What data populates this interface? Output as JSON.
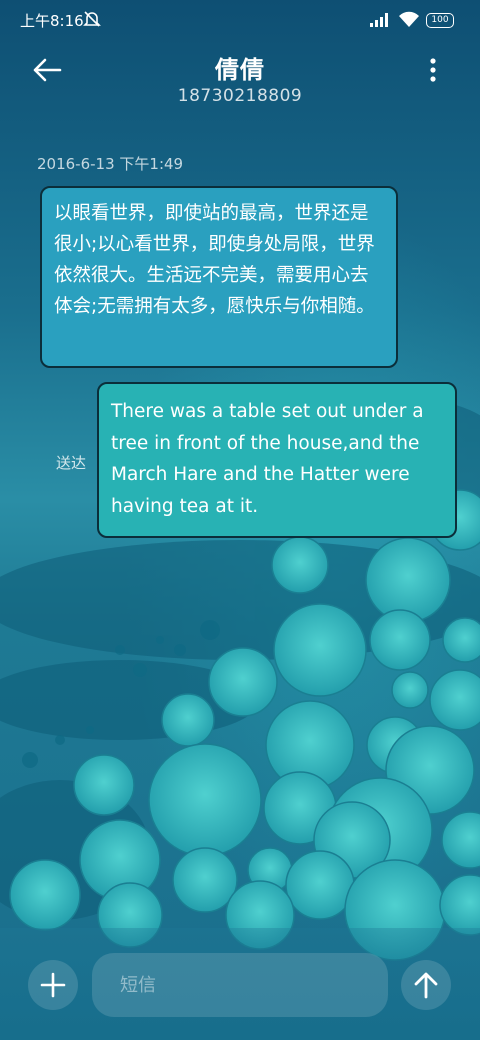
{
  "status_bar": {
    "time": "上午8:16",
    "battery": "100",
    "icons": [
      "mute-icon",
      "signal-icon",
      "wifi-icon",
      "battery-icon"
    ]
  },
  "header": {
    "contact_name": "倩倩",
    "phone_number": "18730218809",
    "icons": [
      "back-arrow-icon",
      "more-vertical-icon"
    ]
  },
  "conversation": {
    "timestamp": "2016-6-13 下午1:49",
    "messages": [
      {
        "direction": "incoming",
        "text": "以眼看世界，即使站的最高，世界还是很小;以心看世界，即使身处局限，世界依然很大。生活远不完美，需要用心去体会;无需拥有太多，愿快乐与你相随。"
      },
      {
        "direction": "outgoing",
        "text": "There was a table set out under a tree in front of the house,and the March Hare and the Hatter were having tea at it.",
        "status": "送达"
      }
    ]
  },
  "composer": {
    "placeholder": "短信",
    "icons": [
      "plus-icon",
      "send-arrow-icon"
    ]
  },
  "colors": {
    "incoming_bubble": "#2aa0bf",
    "outgoing_bubble": "#28b2b4",
    "background_top": "#0e4f73",
    "lily_pad": "#2fb8c0"
  }
}
